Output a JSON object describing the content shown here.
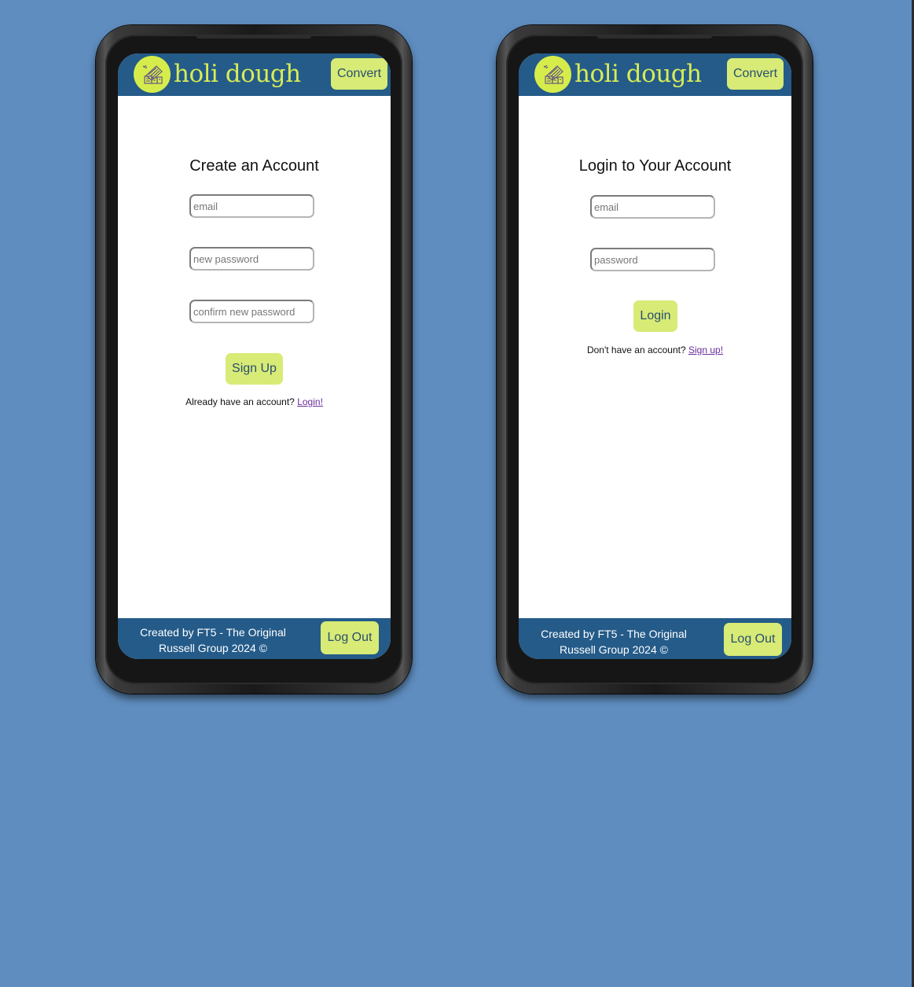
{
  "colors": {
    "background": "#5f8dbf",
    "brand_blue": "#245b89",
    "accent_lime": "#d7eb76",
    "logo_lime": "#d6ec4b",
    "link_purple": "#6a2c9a"
  },
  "app": {
    "brand": "holi dough",
    "logo_icon": "house-with-cash-icon",
    "nav_button": "Convert"
  },
  "screens": [
    {
      "id": "signup",
      "title": "Create an Account",
      "fields": [
        {
          "name": "email",
          "placeholder": "email",
          "value": ""
        },
        {
          "name": "new_password",
          "placeholder": "new password",
          "value": ""
        },
        {
          "name": "confirm_password",
          "placeholder": "confirm new password",
          "value": ""
        }
      ],
      "submit_label": "Sign Up",
      "switch_prompt": "Already have an account?",
      "switch_link": "Login!"
    },
    {
      "id": "login",
      "title": "Login to Your Account",
      "fields": [
        {
          "name": "email",
          "placeholder": "email",
          "value": ""
        },
        {
          "name": "password",
          "placeholder": "password",
          "value": ""
        }
      ],
      "submit_label": "Login",
      "switch_prompt": "Don't have an account?",
      "switch_link": "Sign up!"
    }
  ],
  "footer": {
    "line1": "Created by FT5 - The Original",
    "line2": "Russell Group 2024 ©",
    "logout_label": "Log Out"
  }
}
